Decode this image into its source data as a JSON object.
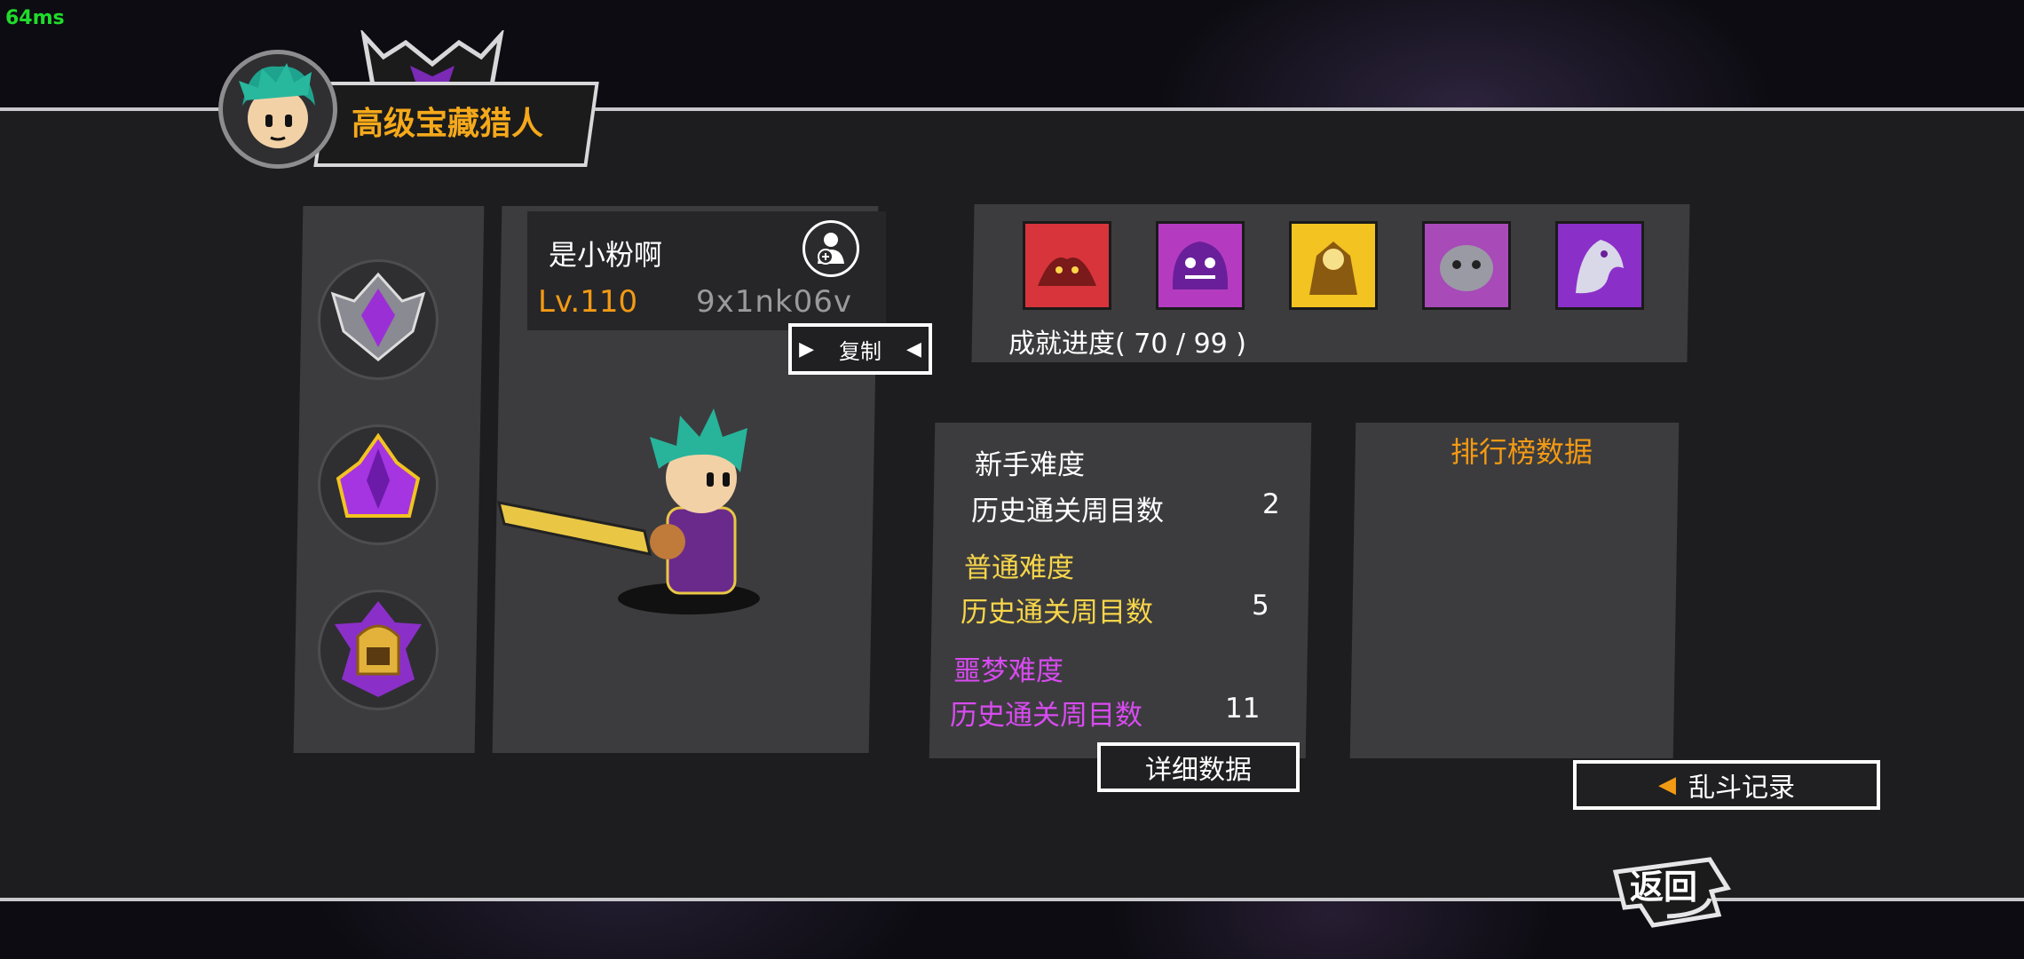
{
  "debug": {
    "latency": "64ms"
  },
  "header": {
    "title": "高级宝藏猎人"
  },
  "player": {
    "name": "是小粉啊",
    "level": "Lv.110",
    "id": "9x1nk06v",
    "copy_label": "复制"
  },
  "achievements": {
    "progress_label": "成就进度( 70 / 99 )",
    "icons": [
      "red-beast-achievement-icon",
      "purple-demon-achievement-icon",
      "gold-warrior-achievement-icon",
      "grey-beast-achievement-icon",
      "purple-dragon-achievement-icon"
    ],
    "frame_colors": [
      "#d8343c",
      "#b43bc0",
      "#f2c321",
      "#a84ab8",
      "#8b2fc9"
    ]
  },
  "stats": {
    "novice": {
      "title": "新手难度",
      "label": "历史通关周目数",
      "value": "2",
      "color": "#ffffff"
    },
    "normal": {
      "title": "普通难度",
      "label": "历史通关周目数",
      "value": "5",
      "color": "#f7d64a"
    },
    "nightmare": {
      "title": "噩梦难度",
      "label": "历史通关周目数",
      "value": "11",
      "color": "#d84bf0"
    },
    "detail_label": "详细数据"
  },
  "ranking": {
    "title": "排行榜数据"
  },
  "buttons": {
    "brawl_record": "乱斗记录",
    "back": "返回"
  },
  "colors": {
    "accent_orange": "#f39a14",
    "band": "#1d1d1f",
    "panel": "#3c3c3e"
  }
}
